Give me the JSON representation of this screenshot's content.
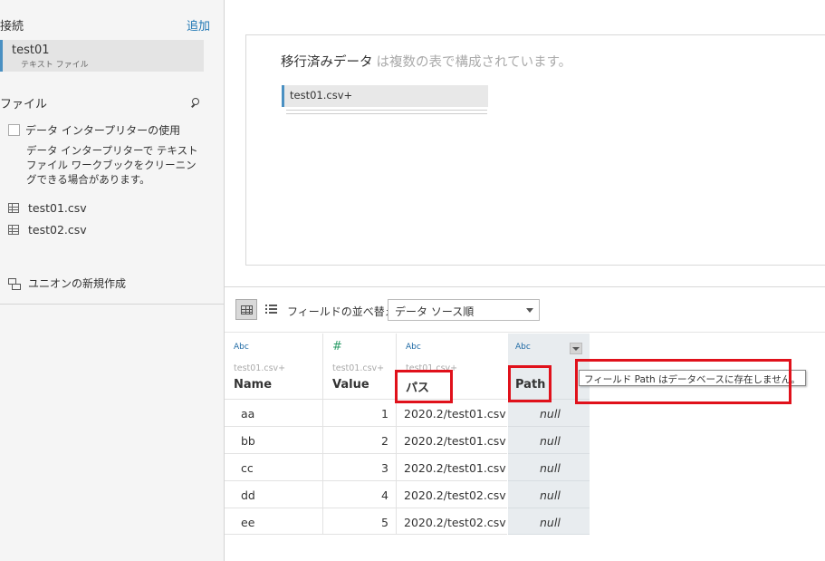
{
  "sidebar": {
    "connections_title": "接続",
    "add_label": "追加",
    "connection": {
      "name": "test01",
      "type": "テキスト ファイル"
    },
    "files_title": "ファイル",
    "interpreter_label": "データ インタープリターの使用",
    "interpreter_desc": "データ インタープリターで テキスト ファイル ワークブックをクリーニングできる場合があります。",
    "files": [
      {
        "name": "test01.csv"
      },
      {
        "name": "test02.csv"
      }
    ],
    "new_union_label": "ユニオンの新規作成"
  },
  "canvas": {
    "title": "移行済みデータ",
    "subtitle": "は複数の表で構成されています。",
    "table_chip": "test01.csv+"
  },
  "toolbar": {
    "sort_label": "フィールドの並べ替え",
    "sort_value": "データ ソース順"
  },
  "grid": {
    "columns": [
      {
        "type": "Abc",
        "source": "test01.csv+",
        "name": "Name"
      },
      {
        "type": "#",
        "source": "test01.csv+",
        "name": "Value"
      },
      {
        "type": "Abc",
        "source": "test01.csv+",
        "name": "パス"
      },
      {
        "type": "Abc",
        "source": "",
        "name": "Path"
      }
    ],
    "rows": [
      [
        "aa",
        "1",
        "2020.2/test01.csv",
        "null"
      ],
      [
        "bb",
        "2",
        "2020.2/test01.csv",
        "null"
      ],
      [
        "cc",
        "3",
        "2020.2/test01.csv",
        "null"
      ],
      [
        "dd",
        "4",
        "2020.2/test02.csv",
        "null"
      ],
      [
        "ee",
        "5",
        "2020.2/test02.csv",
        "null"
      ]
    ]
  },
  "tooltip": "フィールド Path はデータベースに存在しません。"
}
